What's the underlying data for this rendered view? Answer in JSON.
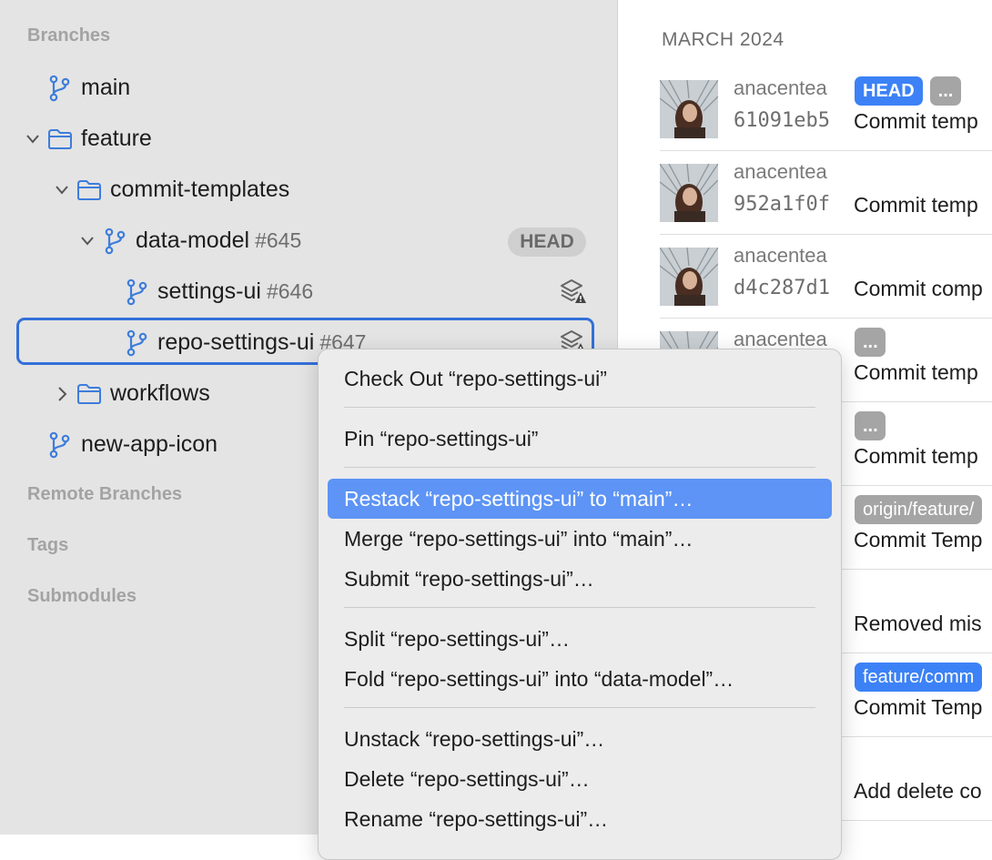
{
  "sidebar": {
    "sections": {
      "branches": "Branches",
      "remote_branches": "Remote Branches",
      "tags": "Tags",
      "submodules": "Submodules"
    },
    "tree": {
      "main": "main",
      "feature": "feature",
      "commit_templates": "commit-templates",
      "data_model": "data-model",
      "data_model_pr": "#645",
      "data_model_badge": "HEAD",
      "settings_ui": "settings-ui",
      "settings_ui_pr": "#646",
      "repo_settings_ui": "repo-settings-ui",
      "repo_settings_ui_pr": "#647",
      "workflows": "workflows",
      "new_app_icon": "new-app-icon"
    }
  },
  "history": {
    "month": "MARCH 2024",
    "commits": [
      {
        "author": "anacentea",
        "hash": "61091eb5",
        "message": "Commit temp",
        "tags": [
          "HEAD",
          "..."
        ]
      },
      {
        "author": "anacentea",
        "hash": "952a1f0f",
        "message": "Commit temp"
      },
      {
        "author": "anacentea",
        "hash": "d4c287d1",
        "message": "Commit comp"
      },
      {
        "author": "anacentea",
        "message": "Commit temp",
        "tags": [
          "..."
        ]
      },
      {
        "message": "Commit temp",
        "tags": [
          "..."
        ]
      },
      {
        "message": "Commit Temp",
        "tags": [
          "origin/feature/"
        ]
      },
      {
        "message": "Removed mis"
      },
      {
        "message": "Commit Temp",
        "tags": [
          "feature/comm"
        ]
      },
      {
        "message": "Add delete co"
      }
    ]
  },
  "context_menu": {
    "items": [
      "Check Out “repo-settings-ui”",
      "Pin “repo-settings-ui”",
      "Restack “repo-settings-ui” to “main”…",
      "Merge “repo-settings-ui” into “main”…",
      "Submit “repo-settings-ui”…",
      "Split “repo-settings-ui”…",
      "Fold “repo-settings-ui” into “data-model”…",
      "Unstack “repo-settings-ui”…",
      "Delete “repo-settings-ui”…",
      "Rename “repo-settings-ui”…"
    ],
    "highlighted_index": 2
  },
  "colors": {
    "accent": "#3c82f6",
    "branch_icon": "#3d7ddc",
    "menu_highlight": "#5d94f5"
  }
}
